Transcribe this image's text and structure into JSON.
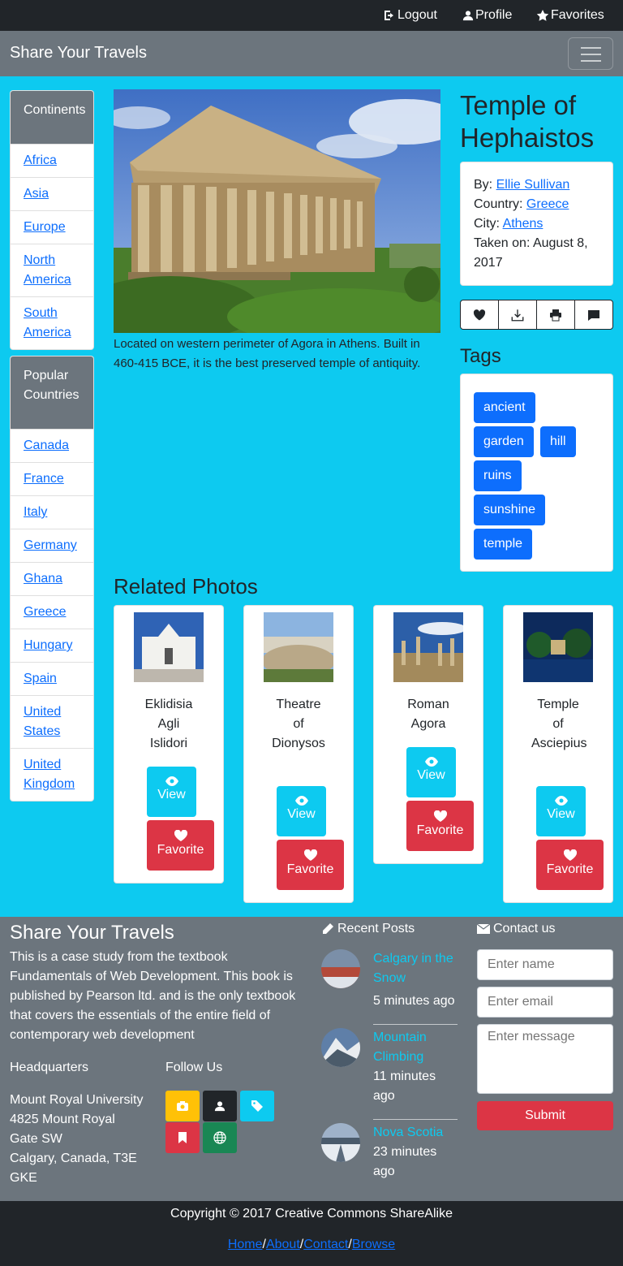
{
  "topbar": {
    "logout": "Logout",
    "profile": "Profile",
    "favorites": "Favorites"
  },
  "brand": "Share Your Travels",
  "sidebar": {
    "continents_title": "Continents",
    "continents": [
      "Africa",
      "Asia",
      "Europe",
      "North America",
      "South America"
    ],
    "countries_title": "Popular Countries",
    "countries": [
      "Canada",
      "France",
      "Italy",
      "Germany",
      "Ghana",
      "Greece",
      "Hungary",
      "Spain",
      "United States",
      "United Kingdom"
    ]
  },
  "photo": {
    "title": "Temple of Hephaistos",
    "caption": "Located on western perimeter of Agora in Athens. Built in 460-415 BCE, it is the best preserved temple of antiquity.",
    "by_label": "By:",
    "author": "Ellie Sullivan",
    "country_label": "Country:",
    "country": "Greece",
    "city_label": "City:",
    "city": "Athens",
    "taken_label": "Taken on:",
    "taken": "August 8, 2017"
  },
  "tags_title": "Tags",
  "tags": [
    "ancient",
    "garden",
    "hill",
    "ruins",
    "sunshine",
    "temple"
  ],
  "related_title": "Related Photos",
  "related": [
    {
      "name": "Eklidisia Agli Islidori",
      "view": "View",
      "fav": "Favorite"
    },
    {
      "name": "Theatre of Dionysos",
      "view": "View",
      "fav": "Favorite"
    },
    {
      "name": "Roman Agora",
      "view": "View",
      "fav": "Favorite"
    },
    {
      "name": "Temple of Asciepius",
      "view": "View",
      "fav": "Favorite"
    }
  ],
  "footer": {
    "title": "Share Your Travels",
    "description": "This is a case study from the textbook Fundamentals of Web Development. This book is published by Pearson ltd. and is the only textbook that covers the essentials of the entire field of contemporary web development",
    "hq_title": "Headquarters",
    "hq_lines": [
      "Mount Royal University",
      "4825 Mount Royal",
      "Gate SW",
      "Calgary, Canada, T3E",
      "GKE"
    ],
    "follow_title": "Follow Us",
    "recent_title": "Recent Posts",
    "posts": [
      {
        "title": "Calgary in the Snow",
        "time": "5 minutes ago"
      },
      {
        "title": "Mountain Climbing",
        "time": "11 minutes ago"
      },
      {
        "title": "Nova Scotia",
        "time": "23 minutes ago"
      }
    ],
    "contact_title": "Contact us",
    "name_placeholder": "Enter name",
    "email_placeholder": "Enter email",
    "message_placeholder": "Enter message",
    "submit": "Submit",
    "copyright": "Copyright © 2017 Creative Commons ShareAlike",
    "links": [
      "Home",
      "About",
      "Contact",
      "Browse"
    ],
    "link_sep": "/"
  },
  "colors": {
    "accent": "#0dcaf0",
    "dark": "#212529",
    "gray": "#6c757d",
    "primary": "#0d6efd",
    "danger": "#dc3545",
    "warning": "#ffc107",
    "success": "#198754"
  }
}
